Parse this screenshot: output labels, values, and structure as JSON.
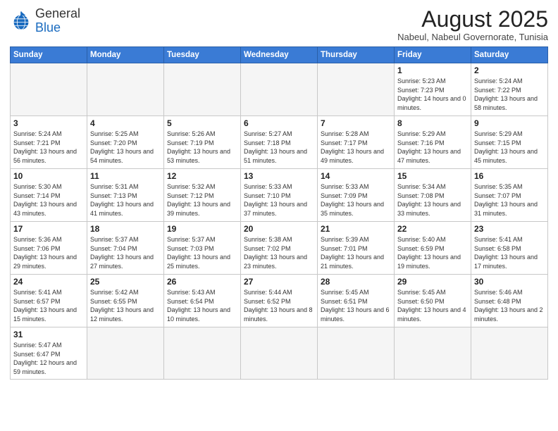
{
  "logo": {
    "general": "General",
    "blue": "Blue"
  },
  "header": {
    "title": "August 2025",
    "subtitle": "Nabeul, Nabeul Governorate, Tunisia"
  },
  "weekdays": [
    "Sunday",
    "Monday",
    "Tuesday",
    "Wednesday",
    "Thursday",
    "Friday",
    "Saturday"
  ],
  "weeks": [
    [
      {
        "day": "",
        "info": ""
      },
      {
        "day": "",
        "info": ""
      },
      {
        "day": "",
        "info": ""
      },
      {
        "day": "",
        "info": ""
      },
      {
        "day": "",
        "info": ""
      },
      {
        "day": "1",
        "info": "Sunrise: 5:23 AM\nSunset: 7:23 PM\nDaylight: 14 hours\nand 0 minutes."
      },
      {
        "day": "2",
        "info": "Sunrise: 5:24 AM\nSunset: 7:22 PM\nDaylight: 13 hours\nand 58 minutes."
      }
    ],
    [
      {
        "day": "3",
        "info": "Sunrise: 5:24 AM\nSunset: 7:21 PM\nDaylight: 13 hours\nand 56 minutes."
      },
      {
        "day": "4",
        "info": "Sunrise: 5:25 AM\nSunset: 7:20 PM\nDaylight: 13 hours\nand 54 minutes."
      },
      {
        "day": "5",
        "info": "Sunrise: 5:26 AM\nSunset: 7:19 PM\nDaylight: 13 hours\nand 53 minutes."
      },
      {
        "day": "6",
        "info": "Sunrise: 5:27 AM\nSunset: 7:18 PM\nDaylight: 13 hours\nand 51 minutes."
      },
      {
        "day": "7",
        "info": "Sunrise: 5:28 AM\nSunset: 7:17 PM\nDaylight: 13 hours\nand 49 minutes."
      },
      {
        "day": "8",
        "info": "Sunrise: 5:29 AM\nSunset: 7:16 PM\nDaylight: 13 hours\nand 47 minutes."
      },
      {
        "day": "9",
        "info": "Sunrise: 5:29 AM\nSunset: 7:15 PM\nDaylight: 13 hours\nand 45 minutes."
      }
    ],
    [
      {
        "day": "10",
        "info": "Sunrise: 5:30 AM\nSunset: 7:14 PM\nDaylight: 13 hours\nand 43 minutes."
      },
      {
        "day": "11",
        "info": "Sunrise: 5:31 AM\nSunset: 7:13 PM\nDaylight: 13 hours\nand 41 minutes."
      },
      {
        "day": "12",
        "info": "Sunrise: 5:32 AM\nSunset: 7:12 PM\nDaylight: 13 hours\nand 39 minutes."
      },
      {
        "day": "13",
        "info": "Sunrise: 5:33 AM\nSunset: 7:10 PM\nDaylight: 13 hours\nand 37 minutes."
      },
      {
        "day": "14",
        "info": "Sunrise: 5:33 AM\nSunset: 7:09 PM\nDaylight: 13 hours\nand 35 minutes."
      },
      {
        "day": "15",
        "info": "Sunrise: 5:34 AM\nSunset: 7:08 PM\nDaylight: 13 hours\nand 33 minutes."
      },
      {
        "day": "16",
        "info": "Sunrise: 5:35 AM\nSunset: 7:07 PM\nDaylight: 13 hours\nand 31 minutes."
      }
    ],
    [
      {
        "day": "17",
        "info": "Sunrise: 5:36 AM\nSunset: 7:06 PM\nDaylight: 13 hours\nand 29 minutes."
      },
      {
        "day": "18",
        "info": "Sunrise: 5:37 AM\nSunset: 7:04 PM\nDaylight: 13 hours\nand 27 minutes."
      },
      {
        "day": "19",
        "info": "Sunrise: 5:37 AM\nSunset: 7:03 PM\nDaylight: 13 hours\nand 25 minutes."
      },
      {
        "day": "20",
        "info": "Sunrise: 5:38 AM\nSunset: 7:02 PM\nDaylight: 13 hours\nand 23 minutes."
      },
      {
        "day": "21",
        "info": "Sunrise: 5:39 AM\nSunset: 7:01 PM\nDaylight: 13 hours\nand 21 minutes."
      },
      {
        "day": "22",
        "info": "Sunrise: 5:40 AM\nSunset: 6:59 PM\nDaylight: 13 hours\nand 19 minutes."
      },
      {
        "day": "23",
        "info": "Sunrise: 5:41 AM\nSunset: 6:58 PM\nDaylight: 13 hours\nand 17 minutes."
      }
    ],
    [
      {
        "day": "24",
        "info": "Sunrise: 5:41 AM\nSunset: 6:57 PM\nDaylight: 13 hours\nand 15 minutes."
      },
      {
        "day": "25",
        "info": "Sunrise: 5:42 AM\nSunset: 6:55 PM\nDaylight: 13 hours\nand 12 minutes."
      },
      {
        "day": "26",
        "info": "Sunrise: 5:43 AM\nSunset: 6:54 PM\nDaylight: 13 hours\nand 10 minutes."
      },
      {
        "day": "27",
        "info": "Sunrise: 5:44 AM\nSunset: 6:52 PM\nDaylight: 13 hours\nand 8 minutes."
      },
      {
        "day": "28",
        "info": "Sunrise: 5:45 AM\nSunset: 6:51 PM\nDaylight: 13 hours\nand 6 minutes."
      },
      {
        "day": "29",
        "info": "Sunrise: 5:45 AM\nSunset: 6:50 PM\nDaylight: 13 hours\nand 4 minutes."
      },
      {
        "day": "30",
        "info": "Sunrise: 5:46 AM\nSunset: 6:48 PM\nDaylight: 13 hours\nand 2 minutes."
      }
    ],
    [
      {
        "day": "31",
        "info": "Sunrise: 5:47 AM\nSunset: 6:47 PM\nDaylight: 12 hours\nand 59 minutes."
      },
      {
        "day": "",
        "info": ""
      },
      {
        "day": "",
        "info": ""
      },
      {
        "day": "",
        "info": ""
      },
      {
        "day": "",
        "info": ""
      },
      {
        "day": "",
        "info": ""
      },
      {
        "day": "",
        "info": ""
      }
    ]
  ]
}
